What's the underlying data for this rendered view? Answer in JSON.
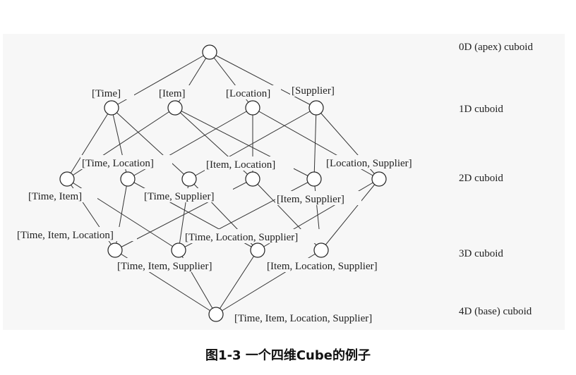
{
  "nodes": {
    "apex": "",
    "time": "[Time]",
    "item": "[Item]",
    "location": "[Location]",
    "supplier": "[Supplier]",
    "time_location": "[Time, Location]",
    "item_location": "[Item, Location]",
    "location_supplier": "[Location, Supplier]",
    "time_item": "[Time, Item]",
    "time_supplier": "[Time, Supplier]",
    "item_supplier": "[Item, Supplier]",
    "time_item_location": "[Time, Item, Location]",
    "time_location_supplier": "[Time, Location, Supplier]",
    "time_item_supplier": "[Time, Item, Supplier]",
    "item_location_supplier": "[Item, Location, Supplier]",
    "base": "[Time, Item, Location, Supplier]"
  },
  "levels": {
    "0d": "0D (apex) cuboid",
    "1d": "1D cuboid",
    "2d": "2D cuboid",
    "3d": "3D cuboid",
    "4d": "4D (base) cuboid"
  },
  "caption": "图1-3  一个四维Cube的例子"
}
